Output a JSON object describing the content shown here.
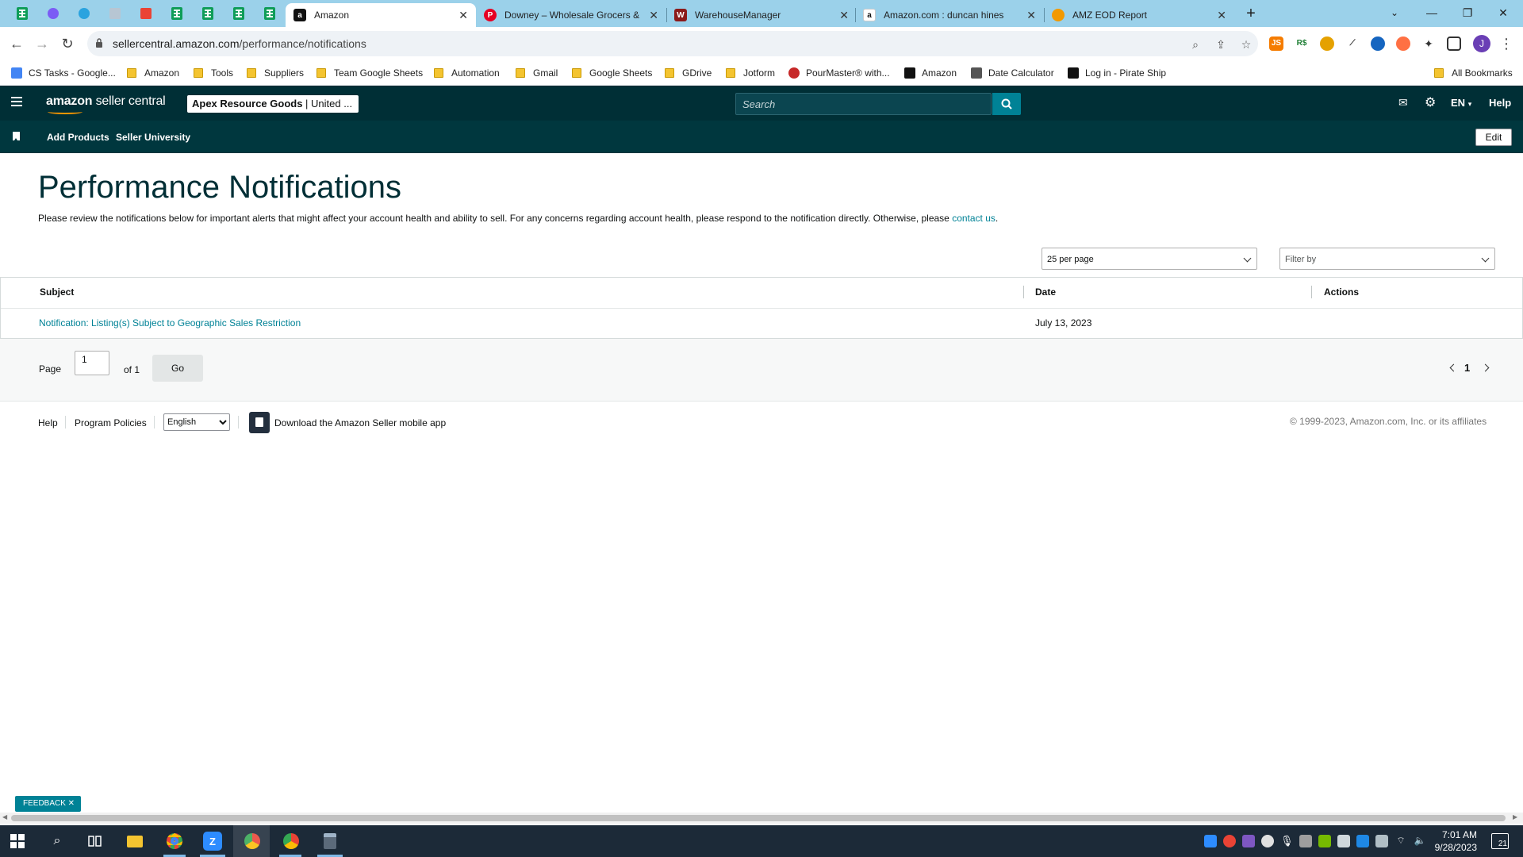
{
  "browser": {
    "tabs": [
      {
        "title": "Amazon",
        "active": true
      },
      {
        "title": "Downey – Wholesale Grocers &"
      },
      {
        "title": "WarehouseManager"
      },
      {
        "title": "Amazon.com : duncan hines"
      },
      {
        "title": "AMZ EOD Report"
      }
    ],
    "url_domain": "sellercentral.amazon.com",
    "url_path": "/performance/notifications",
    "bookmarks": [
      "CS Tasks - Google...",
      "Amazon",
      "Tools",
      "Suppliers",
      "Team Google Sheets",
      "Automation",
      "Gmail",
      "Google Sheets",
      "GDrive",
      "Jotform",
      "PourMaster® with...",
      "Amazon",
      "Date Calculator",
      "Log in - Pirate Ship"
    ],
    "all_bookmarks": "All Bookmarks",
    "profile_initial": "J"
  },
  "header": {
    "logo_bold": "amazon",
    "logo_rest": " seller central",
    "store_name": "Apex Resource Goods",
    "store_region": " | United ...",
    "search_placeholder": "Search",
    "language": "EN",
    "help": "Help"
  },
  "subnav": {
    "links": [
      "Add Products",
      "Seller University"
    ],
    "edit": "Edit"
  },
  "page": {
    "title": "Performance Notifications",
    "intro": "Please review the notifications below for important alerts that might affect your account health and ability to sell. For any concerns regarding account health, please respond to the notification directly. Otherwise, please ",
    "intro_link": "contact us",
    "intro_end": ".",
    "per_page": "25 per page",
    "filter_placeholder": "Filter by"
  },
  "table": {
    "columns": [
      "Subject",
      "Date",
      "Actions"
    ],
    "rows": [
      {
        "subject": "Notification: Listing(s) Subject to Geographic Sales Restriction",
        "date": "July 13, 2023",
        "actions": ""
      }
    ]
  },
  "pagination": {
    "page_label": "Page",
    "current": "1",
    "of_label": "of 1",
    "go": "Go",
    "page_number": "1"
  },
  "footer": {
    "help": "Help",
    "program_policies": "Program Policies",
    "language": "English",
    "app_text": "Download the Amazon Seller mobile app",
    "copyright": "© 1999-2023, Amazon.com, Inc. or its affiliates"
  },
  "feedback": "FEEDBACK ✕",
  "taskbar": {
    "time": "7:01 AM",
    "date": "9/28/2023",
    "notifications": "21"
  },
  "colors": {
    "header_bg": "#002f36",
    "subnav_bg": "#00373e",
    "link": "#008296",
    "accent": "#ff9900",
    "tabstrip": "#9bd1ea"
  }
}
